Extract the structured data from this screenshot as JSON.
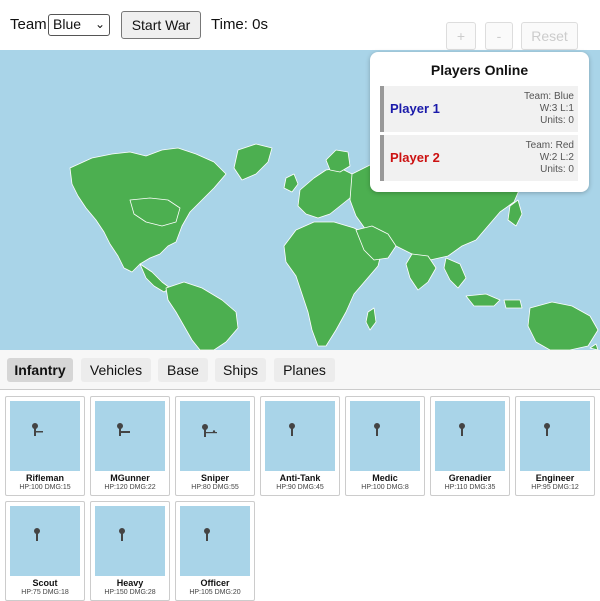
{
  "header": {
    "team_label": "Team:",
    "team_selected": "Blue",
    "start_label": "Start War",
    "time_label": "Time: 0s"
  },
  "map_controls": {
    "zoom_in_label": "+",
    "zoom_out_label": "-",
    "reset_label": "Reset"
  },
  "players_panel": {
    "title": "Players Online",
    "players": [
      {
        "name": "Player 1",
        "team": "Team: Blue",
        "record": "W:3 L:1",
        "units": "Units: 0",
        "color": "#1a1aaa"
      },
      {
        "name": "Player 2",
        "team": "Team: Red",
        "record": "W:2 L:2",
        "units": "Units: 0",
        "color": "#cc1111"
      }
    ]
  },
  "tabs": [
    {
      "label": "Infantry",
      "active": true
    },
    {
      "label": "Vehicles",
      "active": false
    },
    {
      "label": "Base",
      "active": false
    },
    {
      "label": "Ships",
      "active": false
    },
    {
      "label": "Planes",
      "active": false
    }
  ],
  "units": [
    {
      "name": "Rifleman",
      "stats": "HP:100 DMG:15",
      "icon": "rifleman-icon"
    },
    {
      "name": "MGunner",
      "stats": "HP:120 DMG:22",
      "icon": "machine-gunner-icon"
    },
    {
      "name": "Sniper",
      "stats": "HP:80 DMG:55",
      "icon": "sniper-icon"
    },
    {
      "name": "Anti-Tank",
      "stats": "HP:90 DMG:45",
      "icon": "anti-tank-icon"
    },
    {
      "name": "Medic",
      "stats": "HP:100 DMG:8",
      "icon": "medic-icon"
    },
    {
      "name": "Grenadier",
      "stats": "HP:110 DMG:35",
      "icon": "grenadier-icon"
    },
    {
      "name": "Engineer",
      "stats": "HP:95 DMG:12",
      "icon": "engineer-icon"
    },
    {
      "name": "Scout",
      "stats": "HP:75 DMG:18",
      "icon": "scout-icon"
    },
    {
      "name": "Heavy",
      "stats": "HP:150 DMG:28",
      "icon": "heavy-icon"
    },
    {
      "name": "Officer",
      "stats": "HP:105 DMG:20",
      "icon": "officer-icon"
    }
  ],
  "colors": {
    "ocean": "#a9d4e8",
    "land": "#4caf50",
    "player_blue": "#1a1aaa",
    "player_red": "#cc1111"
  }
}
